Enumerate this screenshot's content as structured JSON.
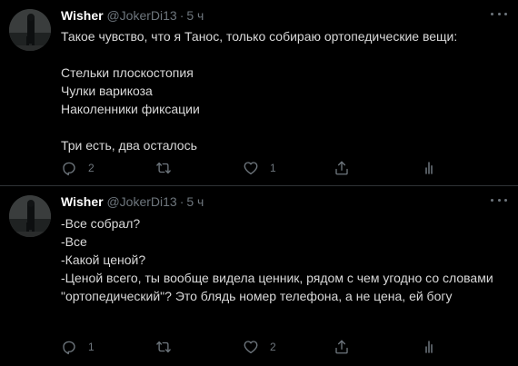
{
  "colors": {
    "background": "#000000",
    "text": "#d9d9d9",
    "name": "#ffffff",
    "muted": "#6e767d",
    "divider": "#2f3336"
  },
  "tweets": [
    {
      "author": {
        "name": "Wisher",
        "handle": "@JokerDi13",
        "separator": "·",
        "time": "5 ч"
      },
      "lines": [
        "Такое чувство, что я Танос, только собираю ортопедические вещи:",
        "",
        "Стельки плоскостопия",
        "Чулки варикоза",
        "Наколенники фиксации",
        "",
        "Три есть, два осталось"
      ],
      "stats": {
        "replies": "2",
        "retweets": "",
        "likes": "1"
      }
    },
    {
      "author": {
        "name": "Wisher",
        "handle": "@JokerDi13",
        "separator": "·",
        "time": "5 ч"
      },
      "lines": [
        "-Все собрал?",
        "-Все",
        "-Какой ценой?",
        "-Ценой всего, ты вообще видела ценник, рядом с чем угодно со словами \"ортопедический\"? Это блядь номер телефона, а не цена, ей богу"
      ],
      "stats": {
        "replies": "1",
        "retweets": "",
        "likes": "2"
      }
    }
  ],
  "icons": {
    "avatar": "avatar-photo",
    "more": "more-horizontal-icon",
    "reply": "reply-icon",
    "retweet": "retweet-icon",
    "like": "heart-icon",
    "share": "share-icon",
    "stats": "analytics-icon"
  }
}
